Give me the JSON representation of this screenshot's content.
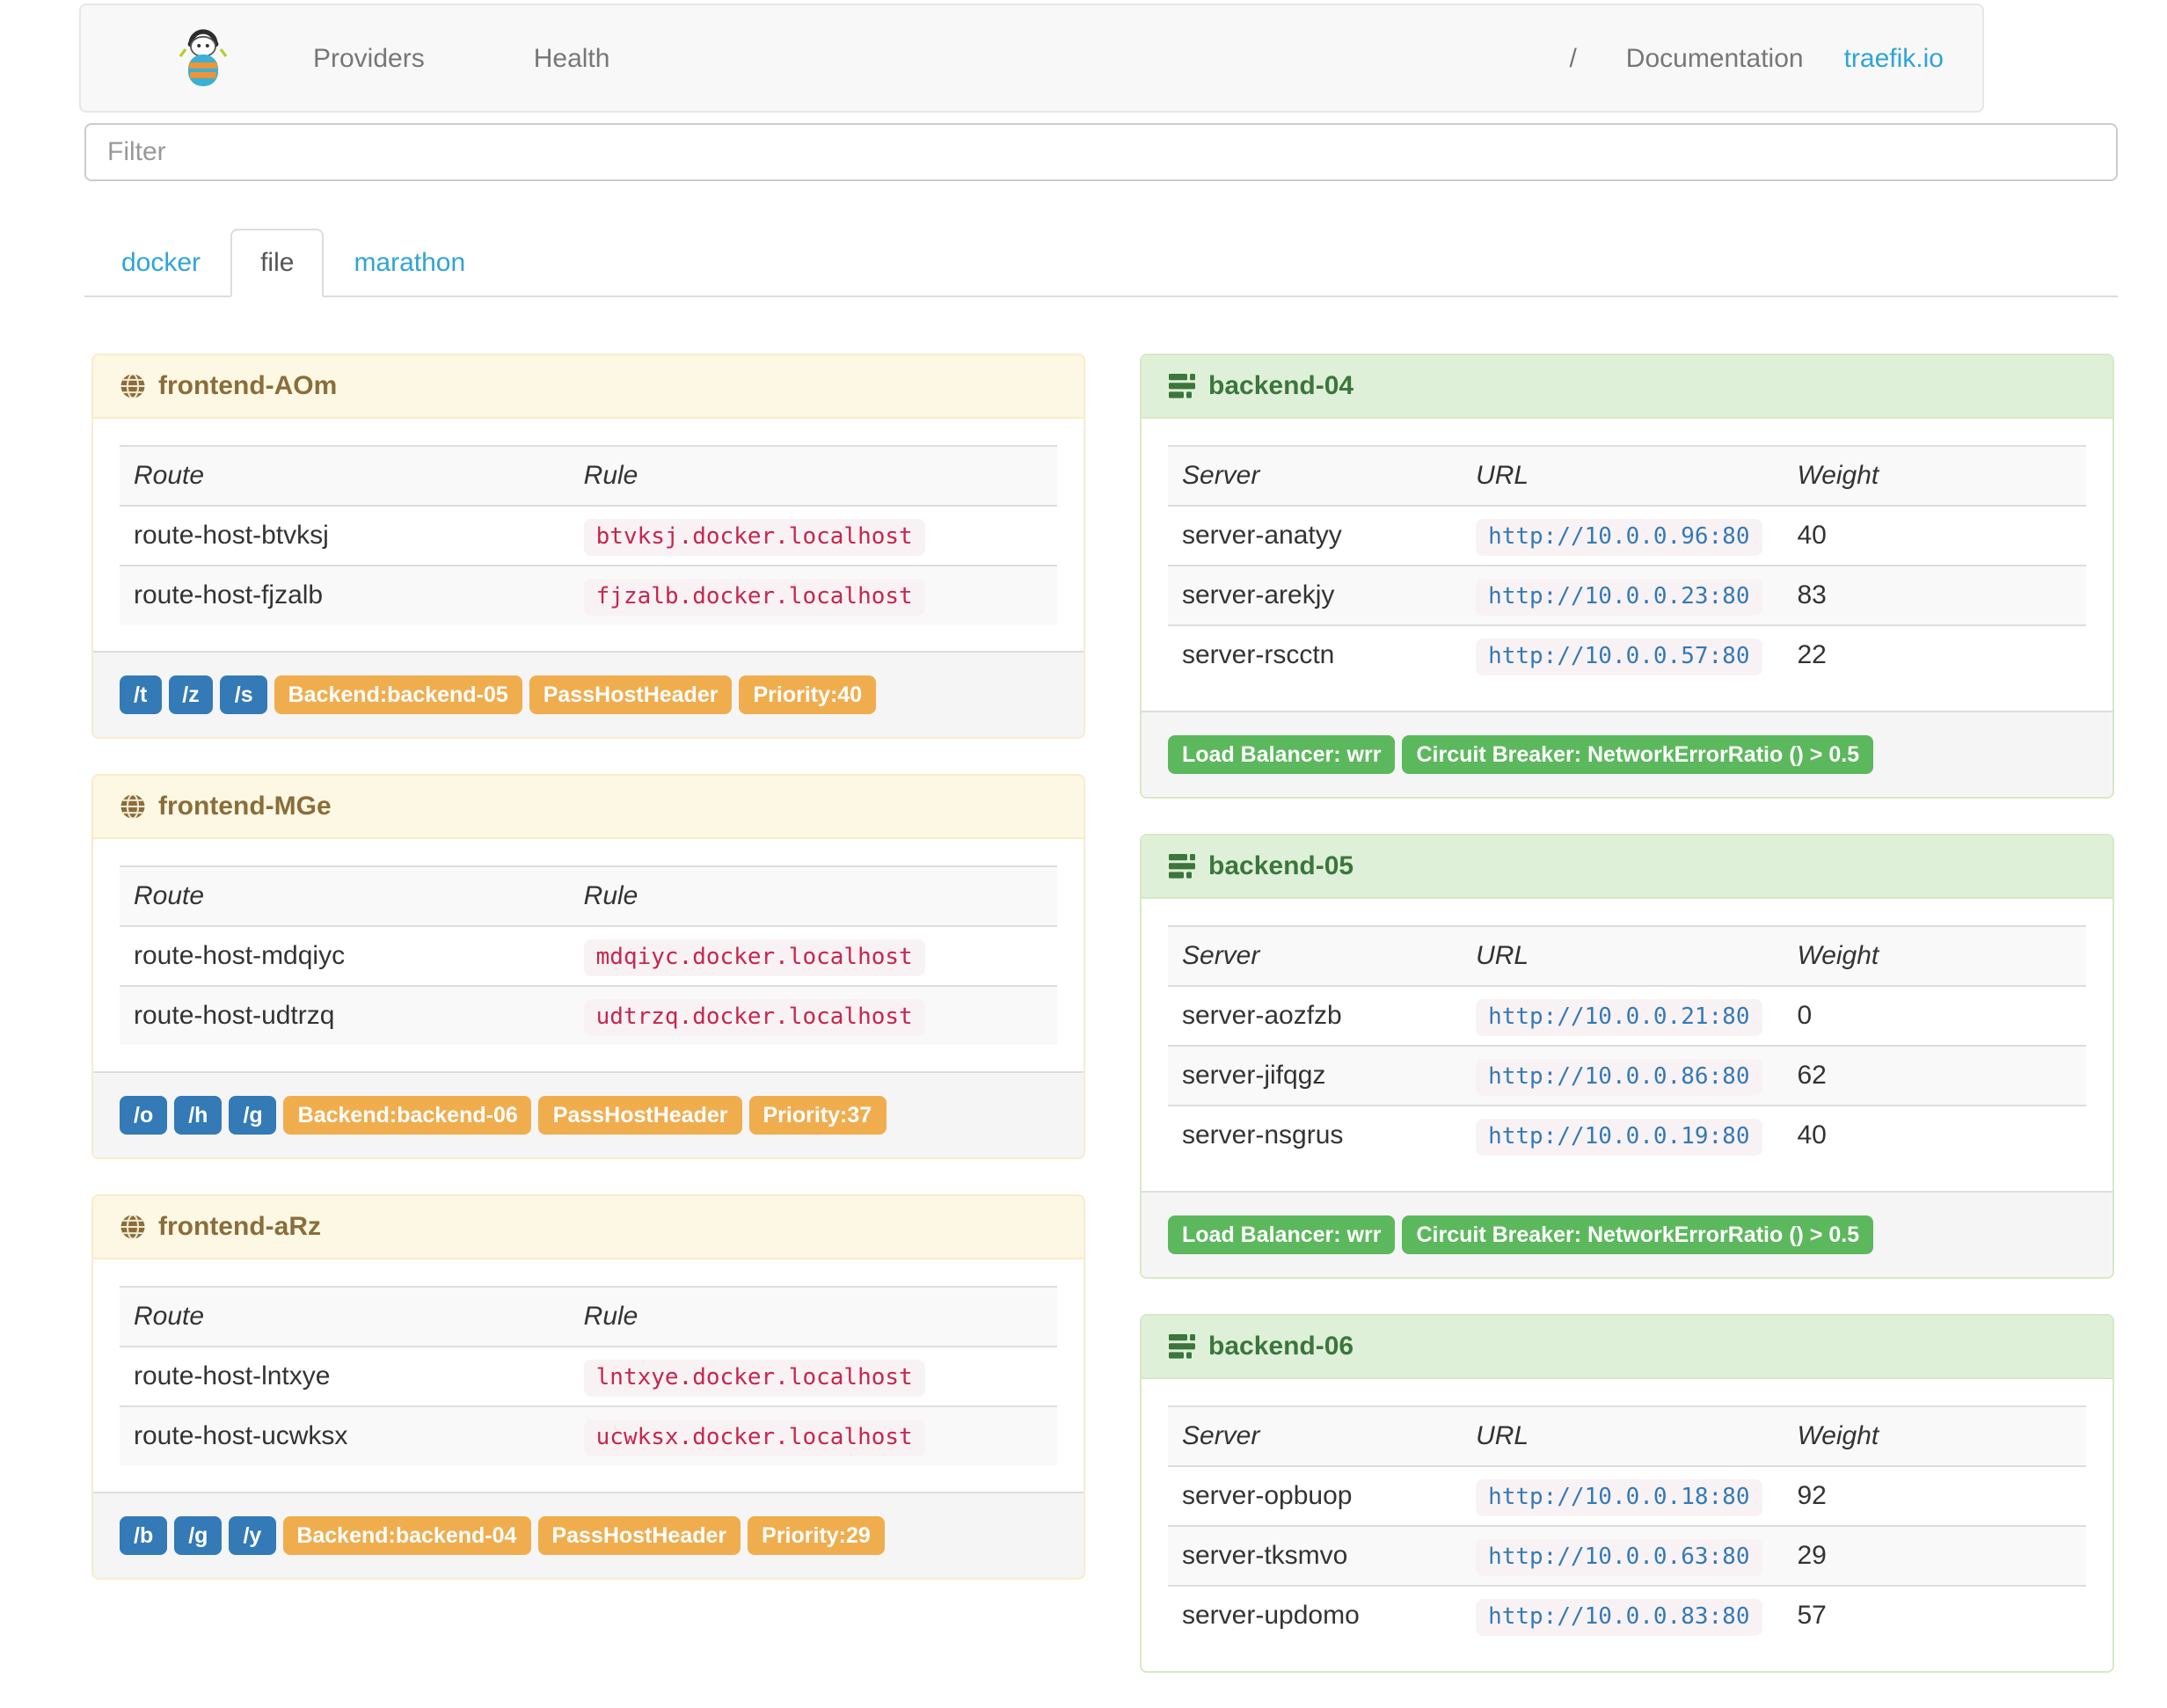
{
  "navbar": {
    "links_left": [
      "Providers",
      "Health"
    ],
    "separator": "/",
    "documentation_label": "Documentation",
    "site_label": "traefik.io"
  },
  "filter": {
    "placeholder": "Filter"
  },
  "tabs": [
    {
      "label": "docker",
      "active": false
    },
    {
      "label": "file",
      "active": true
    },
    {
      "label": "marathon",
      "active": false
    }
  ],
  "frontend_columns": [
    "Route",
    "Rule"
  ],
  "backend_columns": [
    "Server",
    "URL",
    "Weight"
  ],
  "frontends": [
    {
      "title": "frontend-AOm",
      "routes": [
        {
          "route": "route-host-btvksj",
          "rule": "btvksj.docker.localhost"
        },
        {
          "route": "route-host-fjzalb",
          "rule": "fjzalb.docker.localhost"
        }
      ],
      "paths": [
        "/t",
        "/z",
        "/s"
      ],
      "tags": [
        "Backend:backend-05",
        "PassHostHeader",
        "Priority:40"
      ]
    },
    {
      "title": "frontend-MGe",
      "routes": [
        {
          "route": "route-host-mdqiyc",
          "rule": "mdqiyc.docker.localhost"
        },
        {
          "route": "route-host-udtrzq",
          "rule": "udtrzq.docker.localhost"
        }
      ],
      "paths": [
        "/o",
        "/h",
        "/g"
      ],
      "tags": [
        "Backend:backend-06",
        "PassHostHeader",
        "Priority:37"
      ]
    },
    {
      "title": "frontend-aRz",
      "routes": [
        {
          "route": "route-host-lntxye",
          "rule": "lntxye.docker.localhost"
        },
        {
          "route": "route-host-ucwksx",
          "rule": "ucwksx.docker.localhost"
        }
      ],
      "paths": [
        "/b",
        "/g",
        "/y"
      ],
      "tags": [
        "Backend:backend-04",
        "PassHostHeader",
        "Priority:29"
      ]
    }
  ],
  "backends": [
    {
      "title": "backend-04",
      "servers": [
        {
          "server": "server-anatyy",
          "url": "http://10.0.0.96:80",
          "weight": "40"
        },
        {
          "server": "server-arekjy",
          "url": "http://10.0.0.23:80",
          "weight": "83"
        },
        {
          "server": "server-rscctn",
          "url": "http://10.0.0.57:80",
          "weight": "22"
        }
      ],
      "labels": [
        "Load Balancer: wrr",
        "Circuit Breaker: NetworkErrorRatio () > 0.5"
      ]
    },
    {
      "title": "backend-05",
      "servers": [
        {
          "server": "server-aozfzb",
          "url": "http://10.0.0.21:80",
          "weight": "0"
        },
        {
          "server": "server-jifqgz",
          "url": "http://10.0.0.86:80",
          "weight": "62"
        },
        {
          "server": "server-nsgrus",
          "url": "http://10.0.0.19:80",
          "weight": "40"
        }
      ],
      "labels": [
        "Load Balancer: wrr",
        "Circuit Breaker: NetworkErrorRatio () > 0.5"
      ]
    },
    {
      "title": "backend-06",
      "servers": [
        {
          "server": "server-opbuop",
          "url": "http://10.0.0.18:80",
          "weight": "92"
        },
        {
          "server": "server-tksmvo",
          "url": "http://10.0.0.63:80",
          "weight": "29"
        },
        {
          "server": "server-updomo",
          "url": "http://10.0.0.83:80",
          "weight": "57"
        }
      ]
    }
  ],
  "colors": {
    "accent_blue": "#2fa4d9",
    "label_blue": "#337ab7",
    "label_orange": "#f0ad4e",
    "label_green": "#5cb85c",
    "rule_code": "#c7254e"
  }
}
